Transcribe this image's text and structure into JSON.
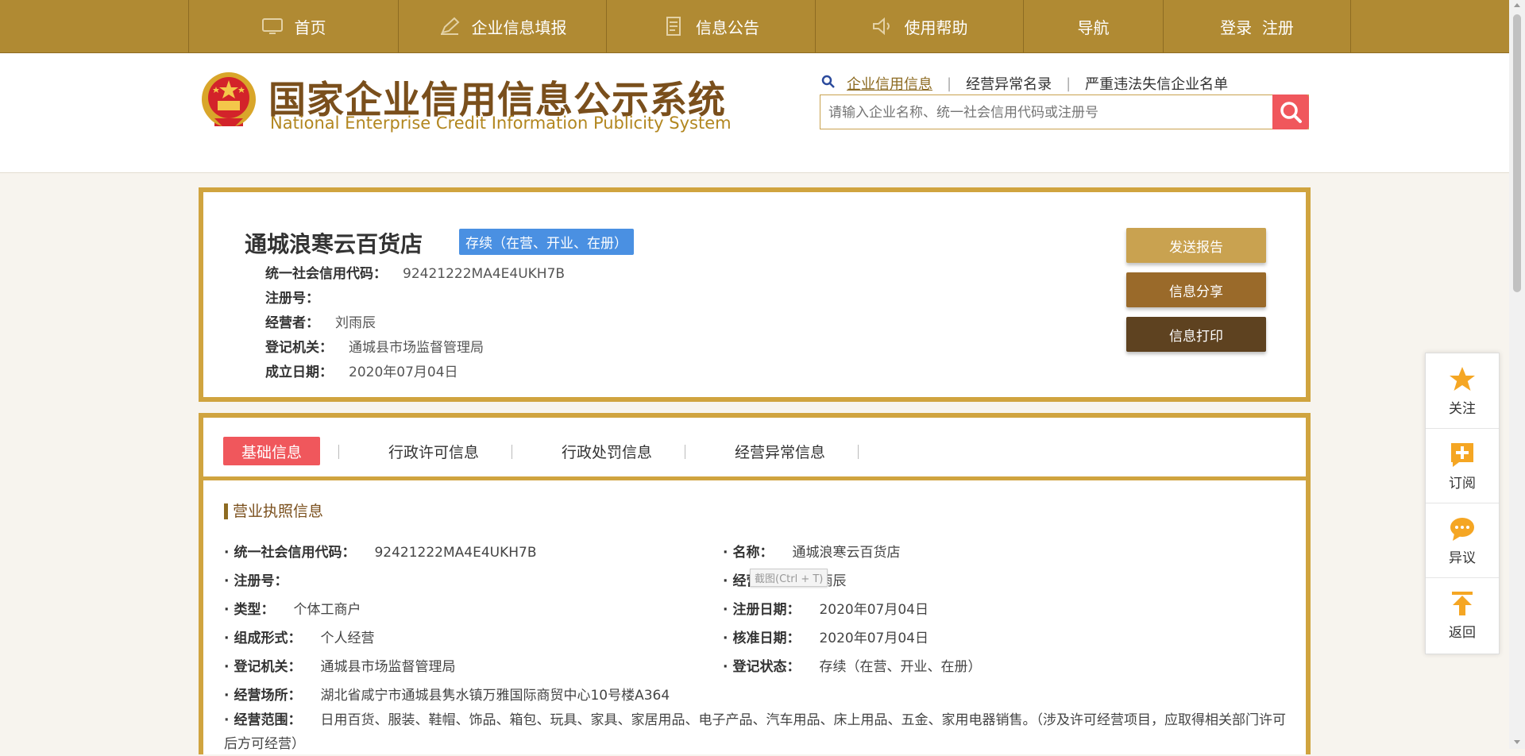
{
  "nav": {
    "items": [
      {
        "label": "首页",
        "icon": "monitor-icon"
      },
      {
        "label": "企业信息填报",
        "icon": "pen-icon"
      },
      {
        "label": "信息公告",
        "icon": "document-icon"
      },
      {
        "label": "使用帮助",
        "icon": "speaker-icon"
      },
      {
        "label": "导航",
        "icon": ""
      },
      {
        "label": "登录  注册",
        "icon": ""
      }
    ]
  },
  "header": {
    "title_cn": "国家企业信用信息公示系统",
    "title_en": "National Enterprise Credit Information Publicity System",
    "search_tabs": [
      "企业信用信息",
      "经营异常名录",
      "严重违法失信企业名单"
    ],
    "search_placeholder": "请输入企业名称、统一社会信用代码或注册号"
  },
  "company": {
    "name": "通城浪寒云百货店",
    "status": "存续（在营、开业、在册）",
    "fields": [
      {
        "label": "统一社会信用代码：",
        "value": "92421222MA4E4UKH7B"
      },
      {
        "label": "注册号：",
        "value": ""
      },
      {
        "label": "经营者：",
        "value": "刘雨辰"
      },
      {
        "label": "登记机关：",
        "value": "通城县市场监督管理局"
      },
      {
        "label": "成立日期：",
        "value": "2020年07月04日"
      }
    ],
    "buttons": [
      {
        "label": "发送报告",
        "color": "#c9a250"
      },
      {
        "label": "信息分享",
        "color": "#9a6a2a"
      },
      {
        "label": "信息打印",
        "color": "#5e4220"
      }
    ]
  },
  "tabs": [
    "基础信息",
    "行政许可信息",
    "行政处罚信息",
    "经营异常信息"
  ],
  "license": {
    "title": "营业执照信息",
    "left": [
      {
        "label": "统一社会信用代码：",
        "value": "92421222MA4E4UKH7B"
      },
      {
        "label": "注册号：",
        "value": ""
      },
      {
        "label": "类型：",
        "value": "个体工商户"
      },
      {
        "label": "组成形式：",
        "value": "个人经营"
      },
      {
        "label": "登记机关：",
        "value": "通城县市场监督管理局"
      },
      {
        "label": "经营场所：",
        "value": "湖北省咸宁市通城县隽水镇万雅国际商贸中心10号楼A364"
      }
    ],
    "right": [
      {
        "label": "名称：",
        "value": "通城浪寒云百货店"
      },
      {
        "label": "经营者：",
        "value": "刘雨辰"
      },
      {
        "label": "注册日期：",
        "value": "2020年07月04日"
      },
      {
        "label": "核准日期：",
        "value": "2020年07月04日"
      },
      {
        "label": "登记状态：",
        "value": "存续（在营、开业、在册）"
      }
    ],
    "scope_label": "经营范围：",
    "scope_value": "日用百货、服装、鞋帽、饰品、箱包、玩具、家具、家居用品、电子产品、汽车用品、床上用品、五金、家用电器销售。（涉及许可经营项目，应取得相关部门许可后方可经营）"
  },
  "tooltip": "截图(Ctrl + T)",
  "side": [
    {
      "label": "关注",
      "icon": "star-icon"
    },
    {
      "label": "订阅",
      "icon": "plus-icon"
    },
    {
      "label": "异议",
      "icon": "chat-icon"
    },
    {
      "label": "返回",
      "icon": "arrow-up-icon"
    }
  ],
  "colors": {
    "nav": "#b08a33",
    "card_border": "#d0a43f",
    "accent_red": "#f0575c",
    "status_blue": "#4a90e2"
  }
}
